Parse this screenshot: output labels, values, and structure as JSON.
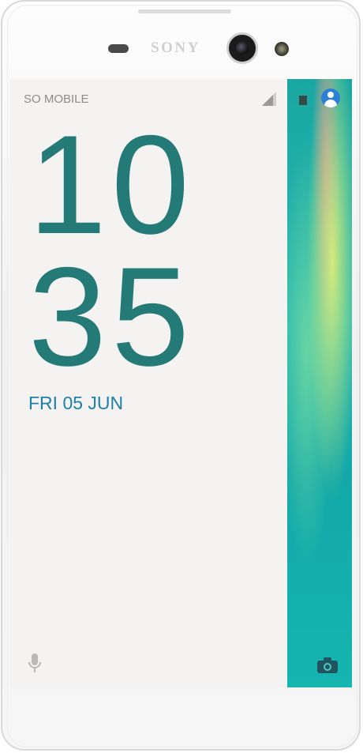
{
  "device": {
    "brand": "SONY"
  },
  "status_bar": {
    "carrier": "SO MOBILE",
    "icons": [
      "signal-icon",
      "battery-icon",
      "user-icon"
    ]
  },
  "lock_screen": {
    "time_hours": "10",
    "time_minutes": "35",
    "date": "FRI 05 JUN",
    "shortcuts": [
      "mic-icon",
      "camera-icon"
    ]
  },
  "colors": {
    "clock": "#247a76",
    "date": "#1e7fa9",
    "wallpaper": "#1aa7a2",
    "user_icon": "#2b7fd6"
  }
}
